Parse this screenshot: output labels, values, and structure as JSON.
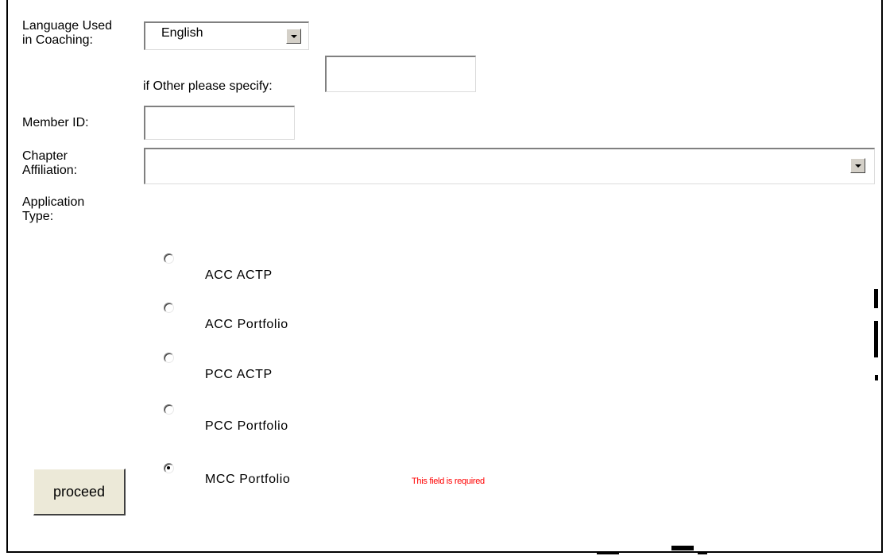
{
  "form": {
    "language_label": "Language Used in Coaching:",
    "language_value": "English",
    "other_label": "if Other please specify:",
    "other_value": "",
    "member_id_label": "Member ID:",
    "member_id_value": "",
    "chapter_label": "Chapter Affiliation:",
    "chapter_value": "",
    "application_label": "Application Type:",
    "options": [
      {
        "label": "ACC ACTP",
        "checked": false
      },
      {
        "label": "ACC Portfolio",
        "checked": false
      },
      {
        "label": "PCC ACTP",
        "checked": false
      },
      {
        "label": "PCC Portfolio",
        "checked": false
      },
      {
        "label": "MCC Portfolio",
        "checked": true
      }
    ],
    "proceed_label": "proceed",
    "error_text": "This field is required"
  },
  "icons": {
    "dropdown": "chevron-down-icon"
  }
}
